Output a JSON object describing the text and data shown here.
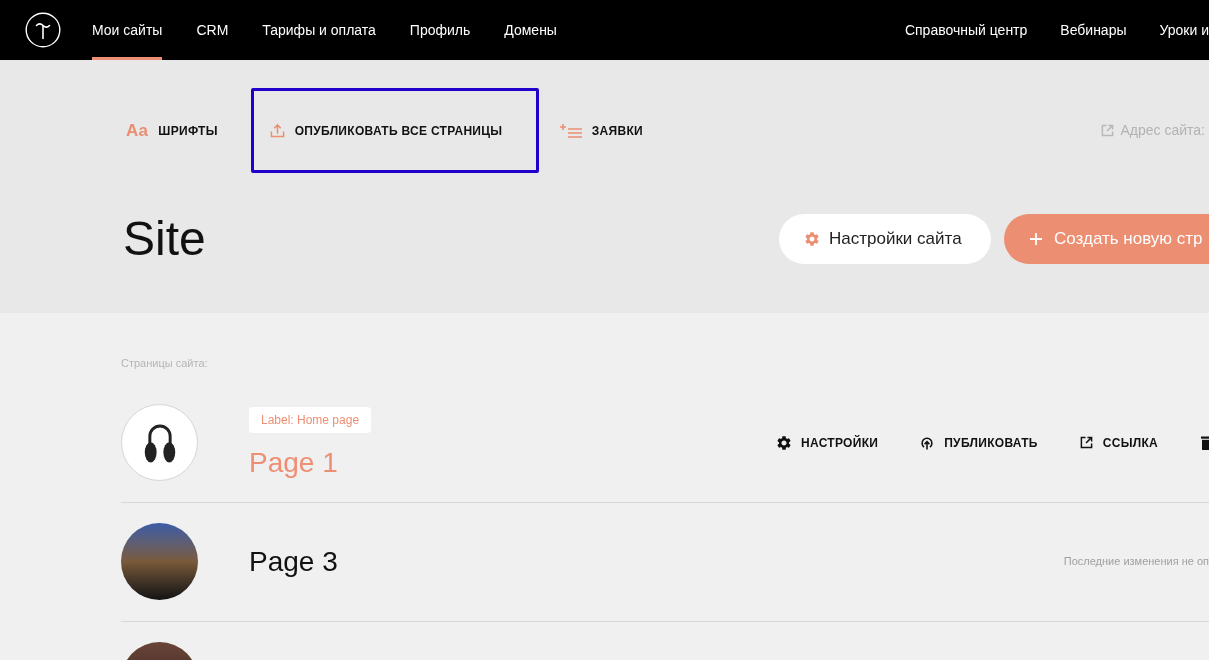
{
  "top_nav": {
    "items": [
      {
        "label": "Мои сайты",
        "selected": true
      },
      {
        "label": "CRM",
        "selected": false
      },
      {
        "label": "Тарифы и оплата",
        "selected": false
      },
      {
        "label": "Профиль",
        "selected": false
      },
      {
        "label": "Домены",
        "selected": false
      }
    ],
    "links": [
      "Справочный центр",
      "Вебинары",
      "Уроки и"
    ]
  },
  "toolbar": {
    "items": [
      {
        "kind": "fonts",
        "icon_text": "Aa",
        "label": "ШРИФТЫ",
        "highlighted": false
      },
      {
        "kind": "publish_all",
        "label": "ОПУБЛИКОВАТЬ ВСЕ СТРАНИЦЫ",
        "highlighted": true
      },
      {
        "kind": "leads",
        "label": "ЗАЯВКИ",
        "highlighted": false
      }
    ],
    "site_address": "Адрес сайта:"
  },
  "site": {
    "title": "Site",
    "buttons": [
      {
        "kind": "settings",
        "label": "Настройки сайта"
      },
      {
        "kind": "create",
        "label": "Создать новую стр"
      }
    ]
  },
  "pages": {
    "heading": "Страницы сайта:",
    "rows": [
      {
        "thumbnail": {
          "kind": "headphones"
        },
        "badge": "Label: Home page",
        "title": "Page 1",
        "hovered": true,
        "actions": [
          {
            "kind": "settings",
            "label": "НАСТРОЙКИ"
          },
          {
            "kind": "publish",
            "label": "ПУБЛИКОВАТЬ"
          },
          {
            "kind": "link",
            "label": "ССЫЛКА"
          },
          {
            "kind": "delete"
          }
        ]
      },
      {
        "thumbnail": {
          "kind": "city"
        },
        "title": "Page 3",
        "hovered": false,
        "status": "Последние изменения не оп"
      },
      {
        "thumbnail": {
          "kind": "dark"
        }
      }
    ]
  }
}
